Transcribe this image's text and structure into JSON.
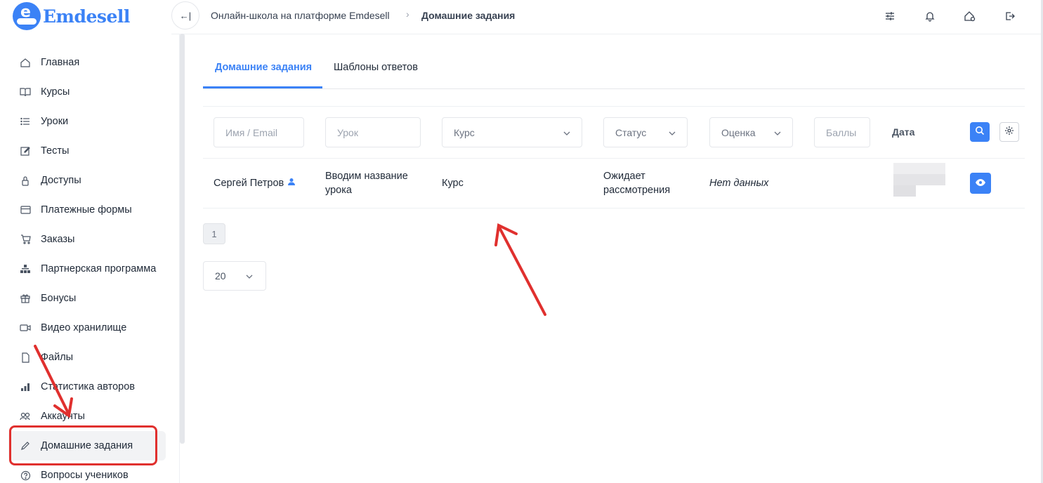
{
  "brand": {
    "name": "Emdesell"
  },
  "header": {
    "collapse_glyph": "←|",
    "breadcrumb_root": "Онлайн-школа на платформе Emdesell",
    "breadcrumb_sep": "›",
    "breadcrumb_current": "Домашние задания",
    "icons": [
      "sliders-icon",
      "bell-icon",
      "home-settings-icon",
      "logout-icon"
    ]
  },
  "sidebar": {
    "items": [
      {
        "label": "Главная",
        "icon": "home-icon"
      },
      {
        "label": "Курсы",
        "icon": "book-icon"
      },
      {
        "label": "Уроки",
        "icon": "list-icon"
      },
      {
        "label": "Тесты",
        "icon": "edit-square-icon"
      },
      {
        "label": "Доступы",
        "icon": "lock-icon"
      },
      {
        "label": "Платежные формы",
        "icon": "credit-card-icon"
      },
      {
        "label": "Заказы",
        "icon": "cart-icon"
      },
      {
        "label": "Партнерская программа",
        "icon": "hierarchy-icon"
      },
      {
        "label": "Бонусы",
        "icon": "gift-icon"
      },
      {
        "label": "Видео хранилище",
        "icon": "video-icon"
      },
      {
        "label": "Файлы",
        "icon": "file-icon"
      },
      {
        "label": "Статистика авторов",
        "icon": "bar-chart-icon"
      },
      {
        "label": "Аккаунты",
        "icon": "users-icon"
      },
      {
        "label": "Домашние задания",
        "icon": "pencil-icon",
        "active": true
      },
      {
        "label": "Вопросы учеников",
        "icon": "question-circle-icon"
      }
    ]
  },
  "tabs": [
    {
      "label": "Домашние задания",
      "active": true
    },
    {
      "label": "Шаблоны ответов",
      "active": false
    }
  ],
  "filters": {
    "name_placeholder": "Имя / Email",
    "lesson_placeholder": "Урок",
    "course_placeholder": "Курс",
    "status_placeholder": "Статус",
    "grade_placeholder": "Оценка",
    "points_placeholder": "Баллы",
    "date_header": "Дата"
  },
  "rows": [
    {
      "student": "Сергей Петров",
      "lesson": "Вводим название урока",
      "course": "Курс",
      "status": "Ожидает рассмотрения",
      "grade": "Нет данных"
    }
  ],
  "pagination": {
    "current_page": "1",
    "per_page": "20"
  },
  "colors": {
    "accent": "#3b82f6",
    "annotation": "#e0302e"
  }
}
